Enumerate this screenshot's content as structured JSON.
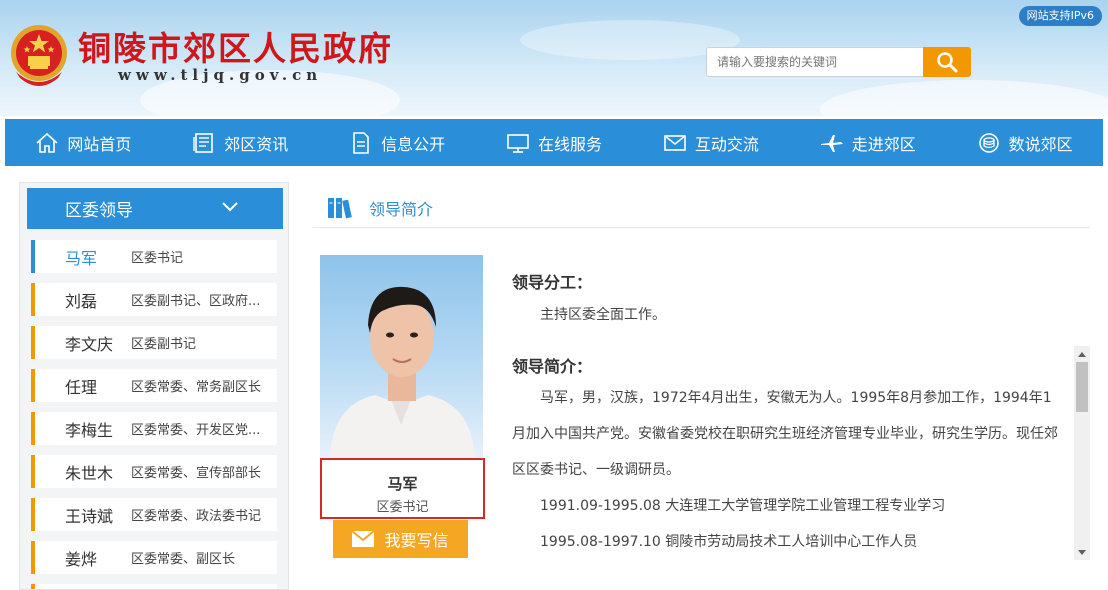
{
  "header": {
    "site_title": "铜陵市郊区人民政府",
    "site_url": "www.tljq.gov.cn",
    "ipv6_badge": "网站支持IPv6",
    "search_placeholder": "请输入要搜索的关键词"
  },
  "nav": {
    "items": [
      {
        "label": "网站首页",
        "icon": "home-icon"
      },
      {
        "label": "郊区资讯",
        "icon": "news-icon"
      },
      {
        "label": "信息公开",
        "icon": "document-icon"
      },
      {
        "label": "在线服务",
        "icon": "monitor-icon"
      },
      {
        "label": "互动交流",
        "icon": "mail-icon"
      },
      {
        "label": "走进郊区",
        "icon": "plane-icon"
      },
      {
        "label": "数说郊区",
        "icon": "database-icon"
      }
    ]
  },
  "sidebar": {
    "title": "区委领导",
    "items": [
      {
        "name": "马军",
        "position": "区委书记"
      },
      {
        "name": "刘磊",
        "position": "区委副书记、区政府..."
      },
      {
        "name": "李文庆",
        "position": "区委副书记"
      },
      {
        "name": "任理",
        "position": "区委常委、常务副区长"
      },
      {
        "name": "李梅生",
        "position": "区委常委、开发区党..."
      },
      {
        "name": "朱世木",
        "position": "区委常委、宣传部部长"
      },
      {
        "name": "王诗斌",
        "position": "区委常委、政法委书记"
      },
      {
        "name": "姜烨",
        "position": "区委常委、副区长"
      }
    ]
  },
  "main": {
    "section_title": "领导简介",
    "leader_name": "马军",
    "leader_position": "区委书记",
    "letter_button": "我要写信",
    "duties_heading": "领导分工：",
    "duties_text": "主持区委全面工作。",
    "profile_heading": "领导简介：",
    "profile_paragraph": "马军，男，汉族，1972年4月出生，安徽无为人。1995年8月参加工作，1994年1月加入中国共产党。安徽省委党校在职研究生班经济管理专业毕业，研究生学历。现任郊区区委书记、一级调研员。",
    "resume": [
      "1991.09-1995.08 大连理工大学管理学院工业管理工程专业学习",
      "1995.08-1997.10 铜陵市劳动局技术工人培训中心工作人员"
    ]
  },
  "colors": {
    "primary_blue": "#2a8fd8",
    "accent_orange": "#f39800",
    "title_red": "#d0161b",
    "highlight_red": "#d8262b"
  }
}
